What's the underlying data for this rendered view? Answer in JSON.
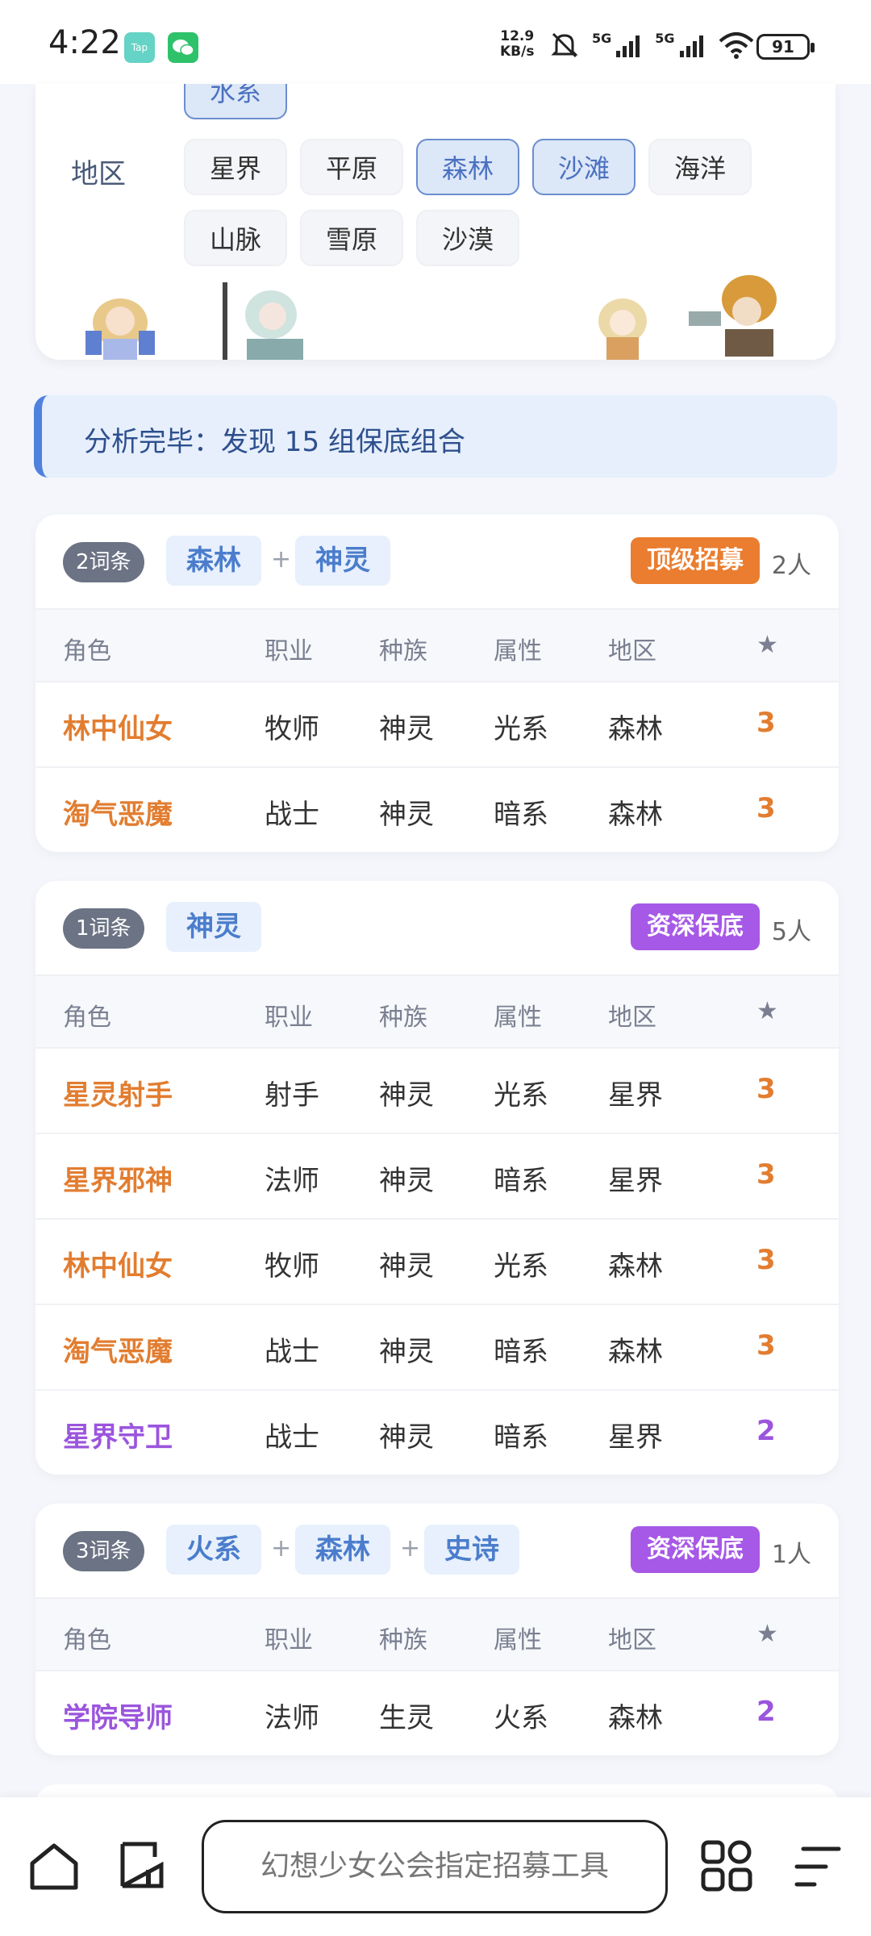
{
  "status_bar": {
    "time": "4:22",
    "net_speed_value": "12.9",
    "net_speed_unit": "KB/s",
    "signal_1": "5G",
    "signal_2": "5G",
    "battery": "91",
    "icons": [
      "tap-app-icon",
      "wechat-icon",
      "mute-icon",
      "signal-icon",
      "wifi-icon",
      "battery-icon"
    ]
  },
  "filters": {
    "partial_chip": "水系",
    "region": {
      "label": "地区",
      "options": [
        {
          "label": "星界",
          "active": false
        },
        {
          "label": "平原",
          "active": false
        },
        {
          "label": "森林",
          "active": true
        },
        {
          "label": "沙滩",
          "active": true
        },
        {
          "label": "海洋",
          "active": false
        },
        {
          "label": "山脉",
          "active": false
        },
        {
          "label": "雪原",
          "active": false
        },
        {
          "label": "沙漠",
          "active": false
        }
      ]
    }
  },
  "analysis": {
    "text": "分析完毕：发现 15 组保底组合"
  },
  "table_headers": {
    "name": "角色",
    "job": "职业",
    "race": "种族",
    "attr": "属性",
    "region": "地区",
    "star": "★"
  },
  "results": [
    {
      "count": "2词条",
      "tags": [
        "森林",
        "神灵"
      ],
      "tier": "顶级招募",
      "tier_color": "#ea7d2f",
      "people": "2人",
      "rows": [
        {
          "name": "林中仙女",
          "job": "牧师",
          "race": "神灵",
          "attr": "光系",
          "region": "森林",
          "star": "3"
        },
        {
          "name": "淘气恶魔",
          "job": "战士",
          "race": "神灵",
          "attr": "暗系",
          "region": "森林",
          "star": "3"
        }
      ]
    },
    {
      "count": "1词条",
      "tags": [
        "神灵"
      ],
      "tier": "资深保底",
      "tier_color": "#a658e6",
      "people": "5人",
      "rows": [
        {
          "name": "星灵射手",
          "job": "射手",
          "race": "神灵",
          "attr": "光系",
          "region": "星界",
          "star": "3"
        },
        {
          "name": "星界邪神",
          "job": "法师",
          "race": "神灵",
          "attr": "暗系",
          "region": "星界",
          "star": "3"
        },
        {
          "name": "林中仙女",
          "job": "牧师",
          "race": "神灵",
          "attr": "光系",
          "region": "森林",
          "star": "3"
        },
        {
          "name": "淘气恶魔",
          "job": "战士",
          "race": "神灵",
          "attr": "暗系",
          "region": "森林",
          "star": "3"
        },
        {
          "name": "星界守卫",
          "job": "战士",
          "race": "神灵",
          "attr": "暗系",
          "region": "星界",
          "star": "2"
        }
      ]
    },
    {
      "count": "3词条",
      "tags": [
        "火系",
        "森林",
        "史诗"
      ],
      "tier": "资深保底",
      "tier_color": "#a658e6",
      "people": "1人",
      "rows": [
        {
          "name": "学院导师",
          "job": "法师",
          "race": "生灵",
          "attr": "火系",
          "region": "森林",
          "star": "2"
        }
      ]
    }
  ],
  "colors": {
    "three_star": "#e27d30",
    "two_star": "#9b55dd",
    "accent": "#4f81dd"
  },
  "bottom_bar": {
    "address": "幻想少女公会指定招募工具",
    "icons": [
      "home-icon",
      "tabs-icon",
      "apps-icon",
      "menu-icon"
    ]
  }
}
